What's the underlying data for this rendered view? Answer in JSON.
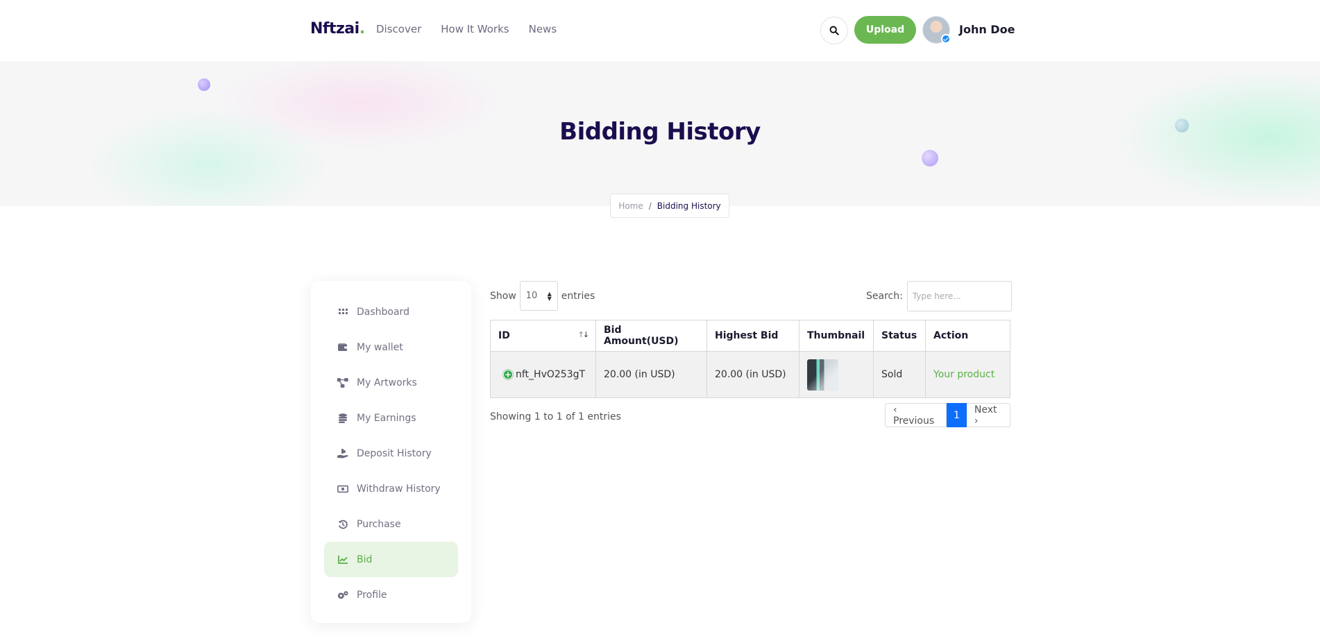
{
  "header": {
    "logo": "Nftzai",
    "logo_dot": ".",
    "nav": [
      "Discover",
      "How It Works",
      "News"
    ],
    "upload_label": "Upload",
    "username": "John Doe"
  },
  "hero": {
    "title": "Bidding History",
    "breadcrumb": {
      "home": "Home",
      "separator": "/",
      "current": "Bidding History"
    }
  },
  "sidebar": {
    "items": [
      {
        "label": "Dashboard",
        "icon": "grid-icon"
      },
      {
        "label": "My wallet",
        "icon": "wallet-icon"
      },
      {
        "label": "My Artworks",
        "icon": "nodes-icon"
      },
      {
        "label": "My Earnings",
        "icon": "coins-icon"
      },
      {
        "label": "Deposit History",
        "icon": "hand-coin-icon"
      },
      {
        "label": "Withdraw History",
        "icon": "money-icon"
      },
      {
        "label": "Purchase",
        "icon": "history-icon"
      },
      {
        "label": "Bid",
        "icon": "chart-line-icon",
        "active": true
      },
      {
        "label": "Profile",
        "icon": "gears-icon"
      }
    ]
  },
  "table_controls": {
    "show_label": "Show",
    "entries_value": "10",
    "entries_label": "entries",
    "search_label": "Search:",
    "search_placeholder": "Type here..."
  },
  "table": {
    "columns": [
      "ID",
      "Bid Amount(USD)",
      "Highest Bid",
      "Thumbnail",
      "Status",
      "Action"
    ],
    "rows": [
      {
        "id": "nft_HvO253gT",
        "bid_amount": "20.00 (in USD)",
        "highest_bid": "20.00 (in USD)",
        "status": "Sold",
        "action": "Your product"
      }
    ]
  },
  "footer": {
    "showing": "Showing 1 to 1 of 1 entries",
    "prev": "‹ Previous",
    "page": "1",
    "next": "Next ›"
  },
  "colors": {
    "brand_dark": "#1b0d4e",
    "accent_green": "#6bb852",
    "active_bg": "#e8f4e4",
    "page_button": "#0d6efd"
  }
}
